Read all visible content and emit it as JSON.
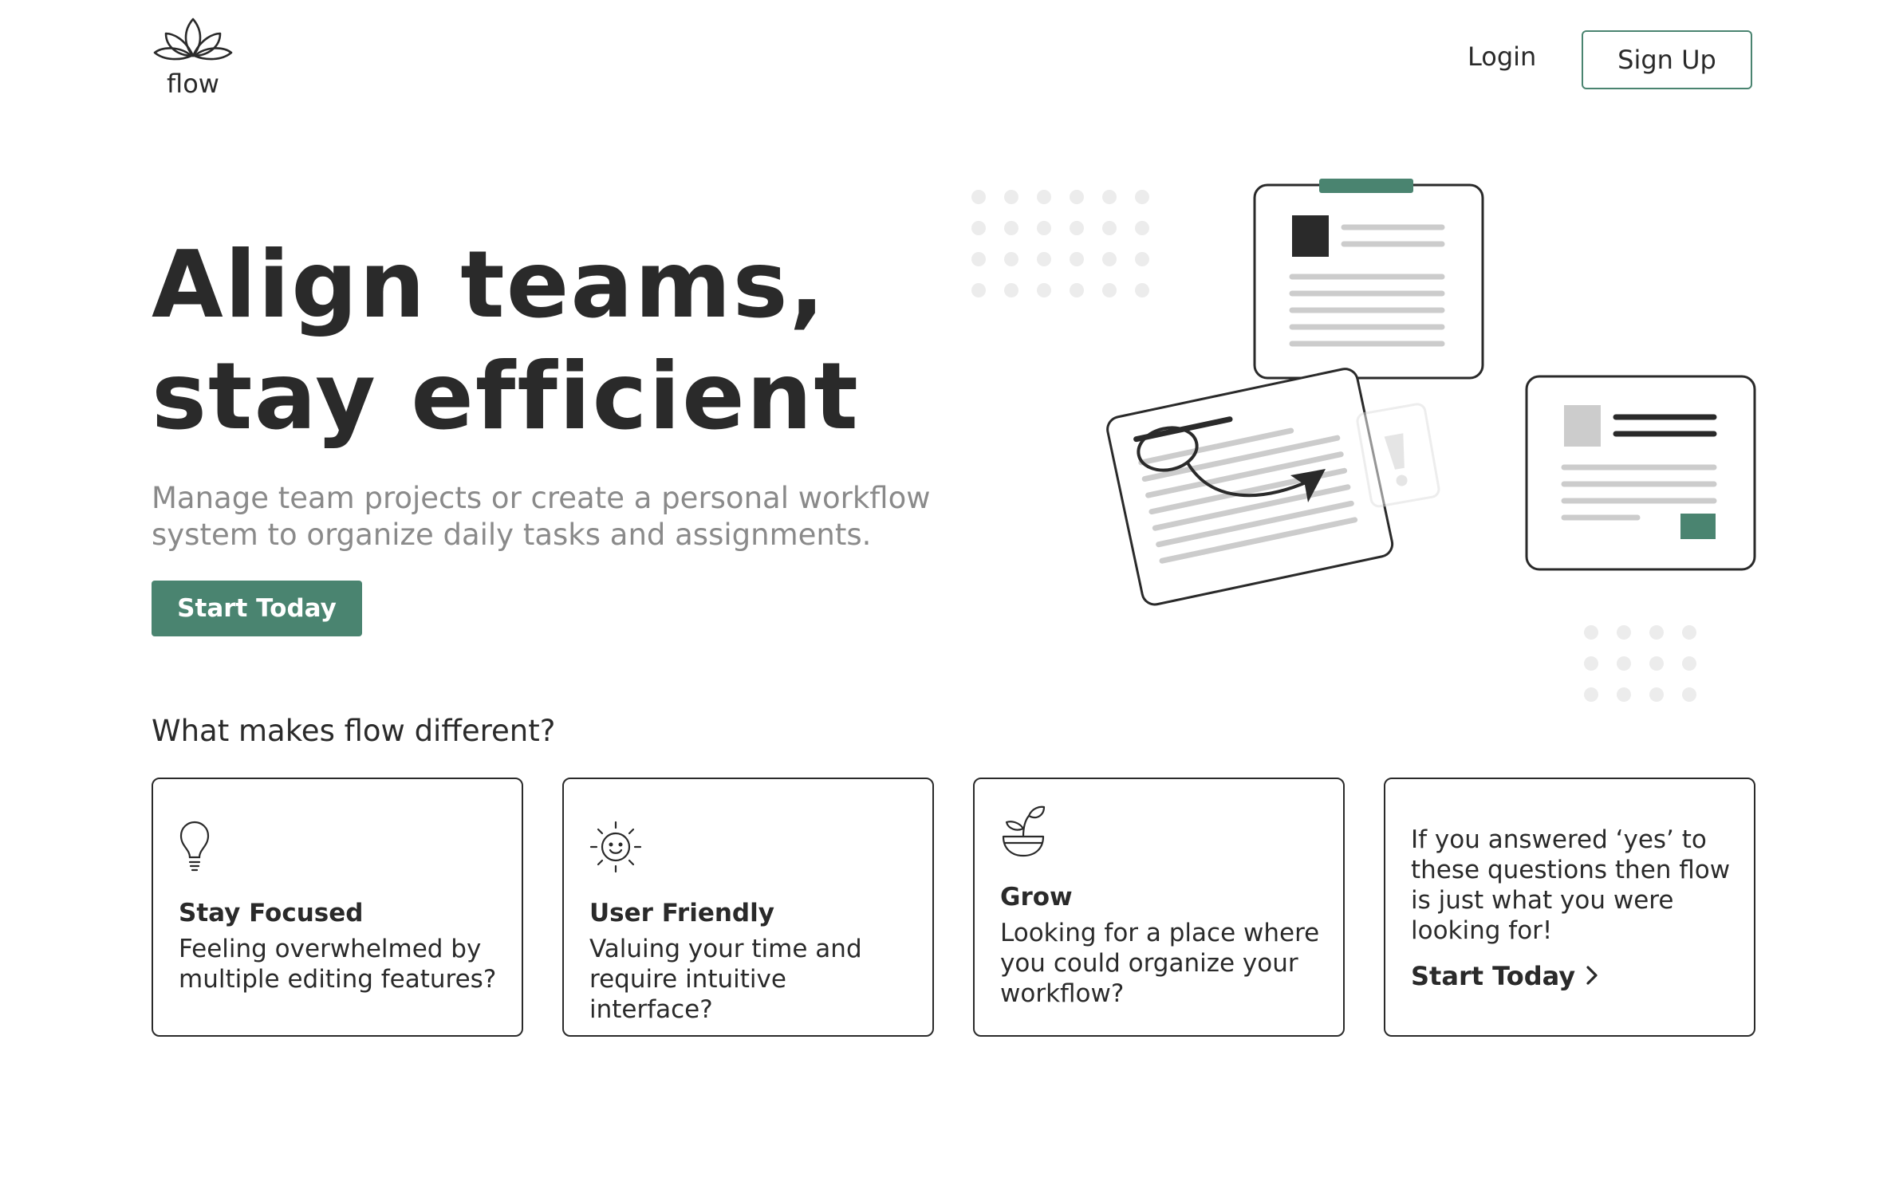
{
  "brand": {
    "name": "flow"
  },
  "header": {
    "login_label": "Login",
    "signup_label": "Sign Up"
  },
  "hero": {
    "title_line1": "Align teams,",
    "title_line2": "stay efficient",
    "subtitle": "Manage team projects or create a personal workflow system to organize daily tasks and assignments.",
    "cta_label": "Start Today"
  },
  "features": {
    "heading": "What makes flow different?",
    "cards": [
      {
        "icon": "lightbulb-icon",
        "title": "Stay Focused",
        "description": "Feeling overwhelmed by multiple editing features?"
      },
      {
        "icon": "smiling-sun-icon",
        "title": "User Friendly",
        "description": "Valuing your time and require intuitive interface?"
      },
      {
        "icon": "plant-sprout-icon",
        "title": "Grow",
        "description": "Looking for a place where you could organize your workflow?"
      }
    ],
    "cta_card": {
      "text": "If you answered ‘yes’ to these questions then flow is just what you were looking for!",
      "link_label": "Start Today",
      "link_icon": "chevron-right-icon"
    }
  },
  "colors": {
    "accent": "#4a8470",
    "text": "#2a2a2a",
    "muted": "#8a8a8a",
    "light_gray": "#cccccc"
  }
}
